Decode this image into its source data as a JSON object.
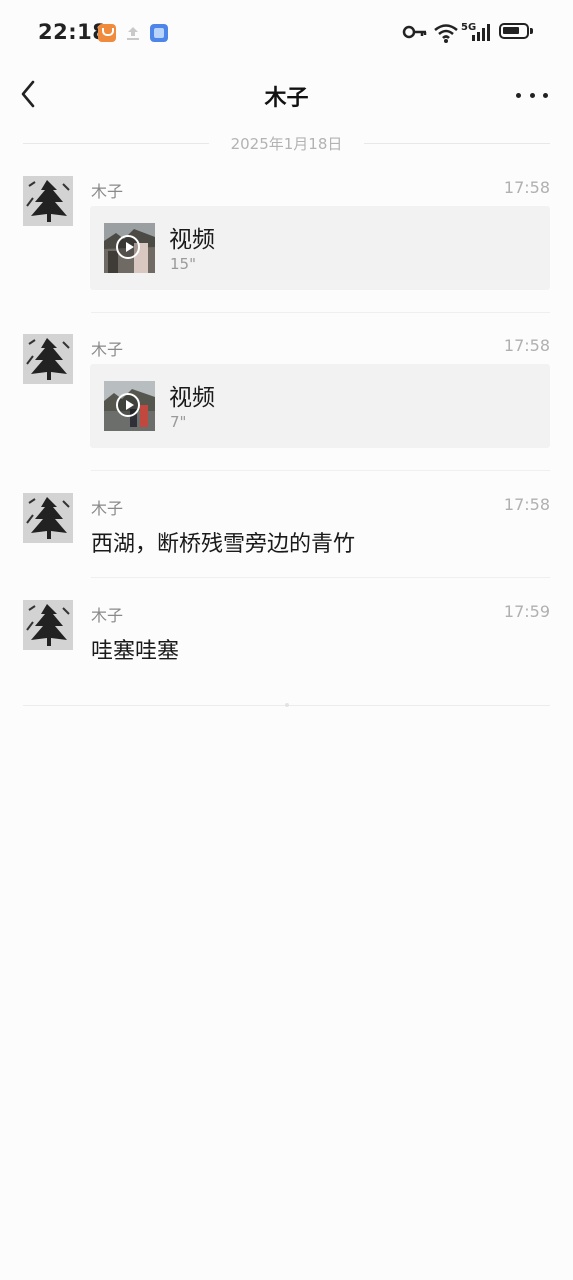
{
  "status_bar": {
    "time": "22:18",
    "network": "5G",
    "icons": [
      "taobao-icon",
      "upload-icon",
      "app-icon",
      "vpn-key-icon",
      "wifi-icon",
      "signal-icon",
      "battery-icon"
    ]
  },
  "header": {
    "title": "木子",
    "back_icon": "chevron-left-icon",
    "more_icon": "more-icon"
  },
  "date_separator": "2025年1月18日",
  "messages": [
    {
      "sender": "木子",
      "time": "17:58",
      "type": "video",
      "title": "视频",
      "duration": "15\""
    },
    {
      "sender": "木子",
      "time": "17:58",
      "type": "video",
      "title": "视频",
      "duration": "7\""
    },
    {
      "sender": "木子",
      "time": "17:58",
      "type": "text",
      "text": "西湖，断桥残雪旁边的青竹"
    },
    {
      "sender": "木子",
      "time": "17:59",
      "type": "text",
      "text": "哇塞哇塞"
    }
  ],
  "colors": {
    "background": "#fdfcfd",
    "video_card": "#f3f2f3",
    "secondary_text": "#8a8a8a",
    "timestamp": "#b0b0b0"
  }
}
